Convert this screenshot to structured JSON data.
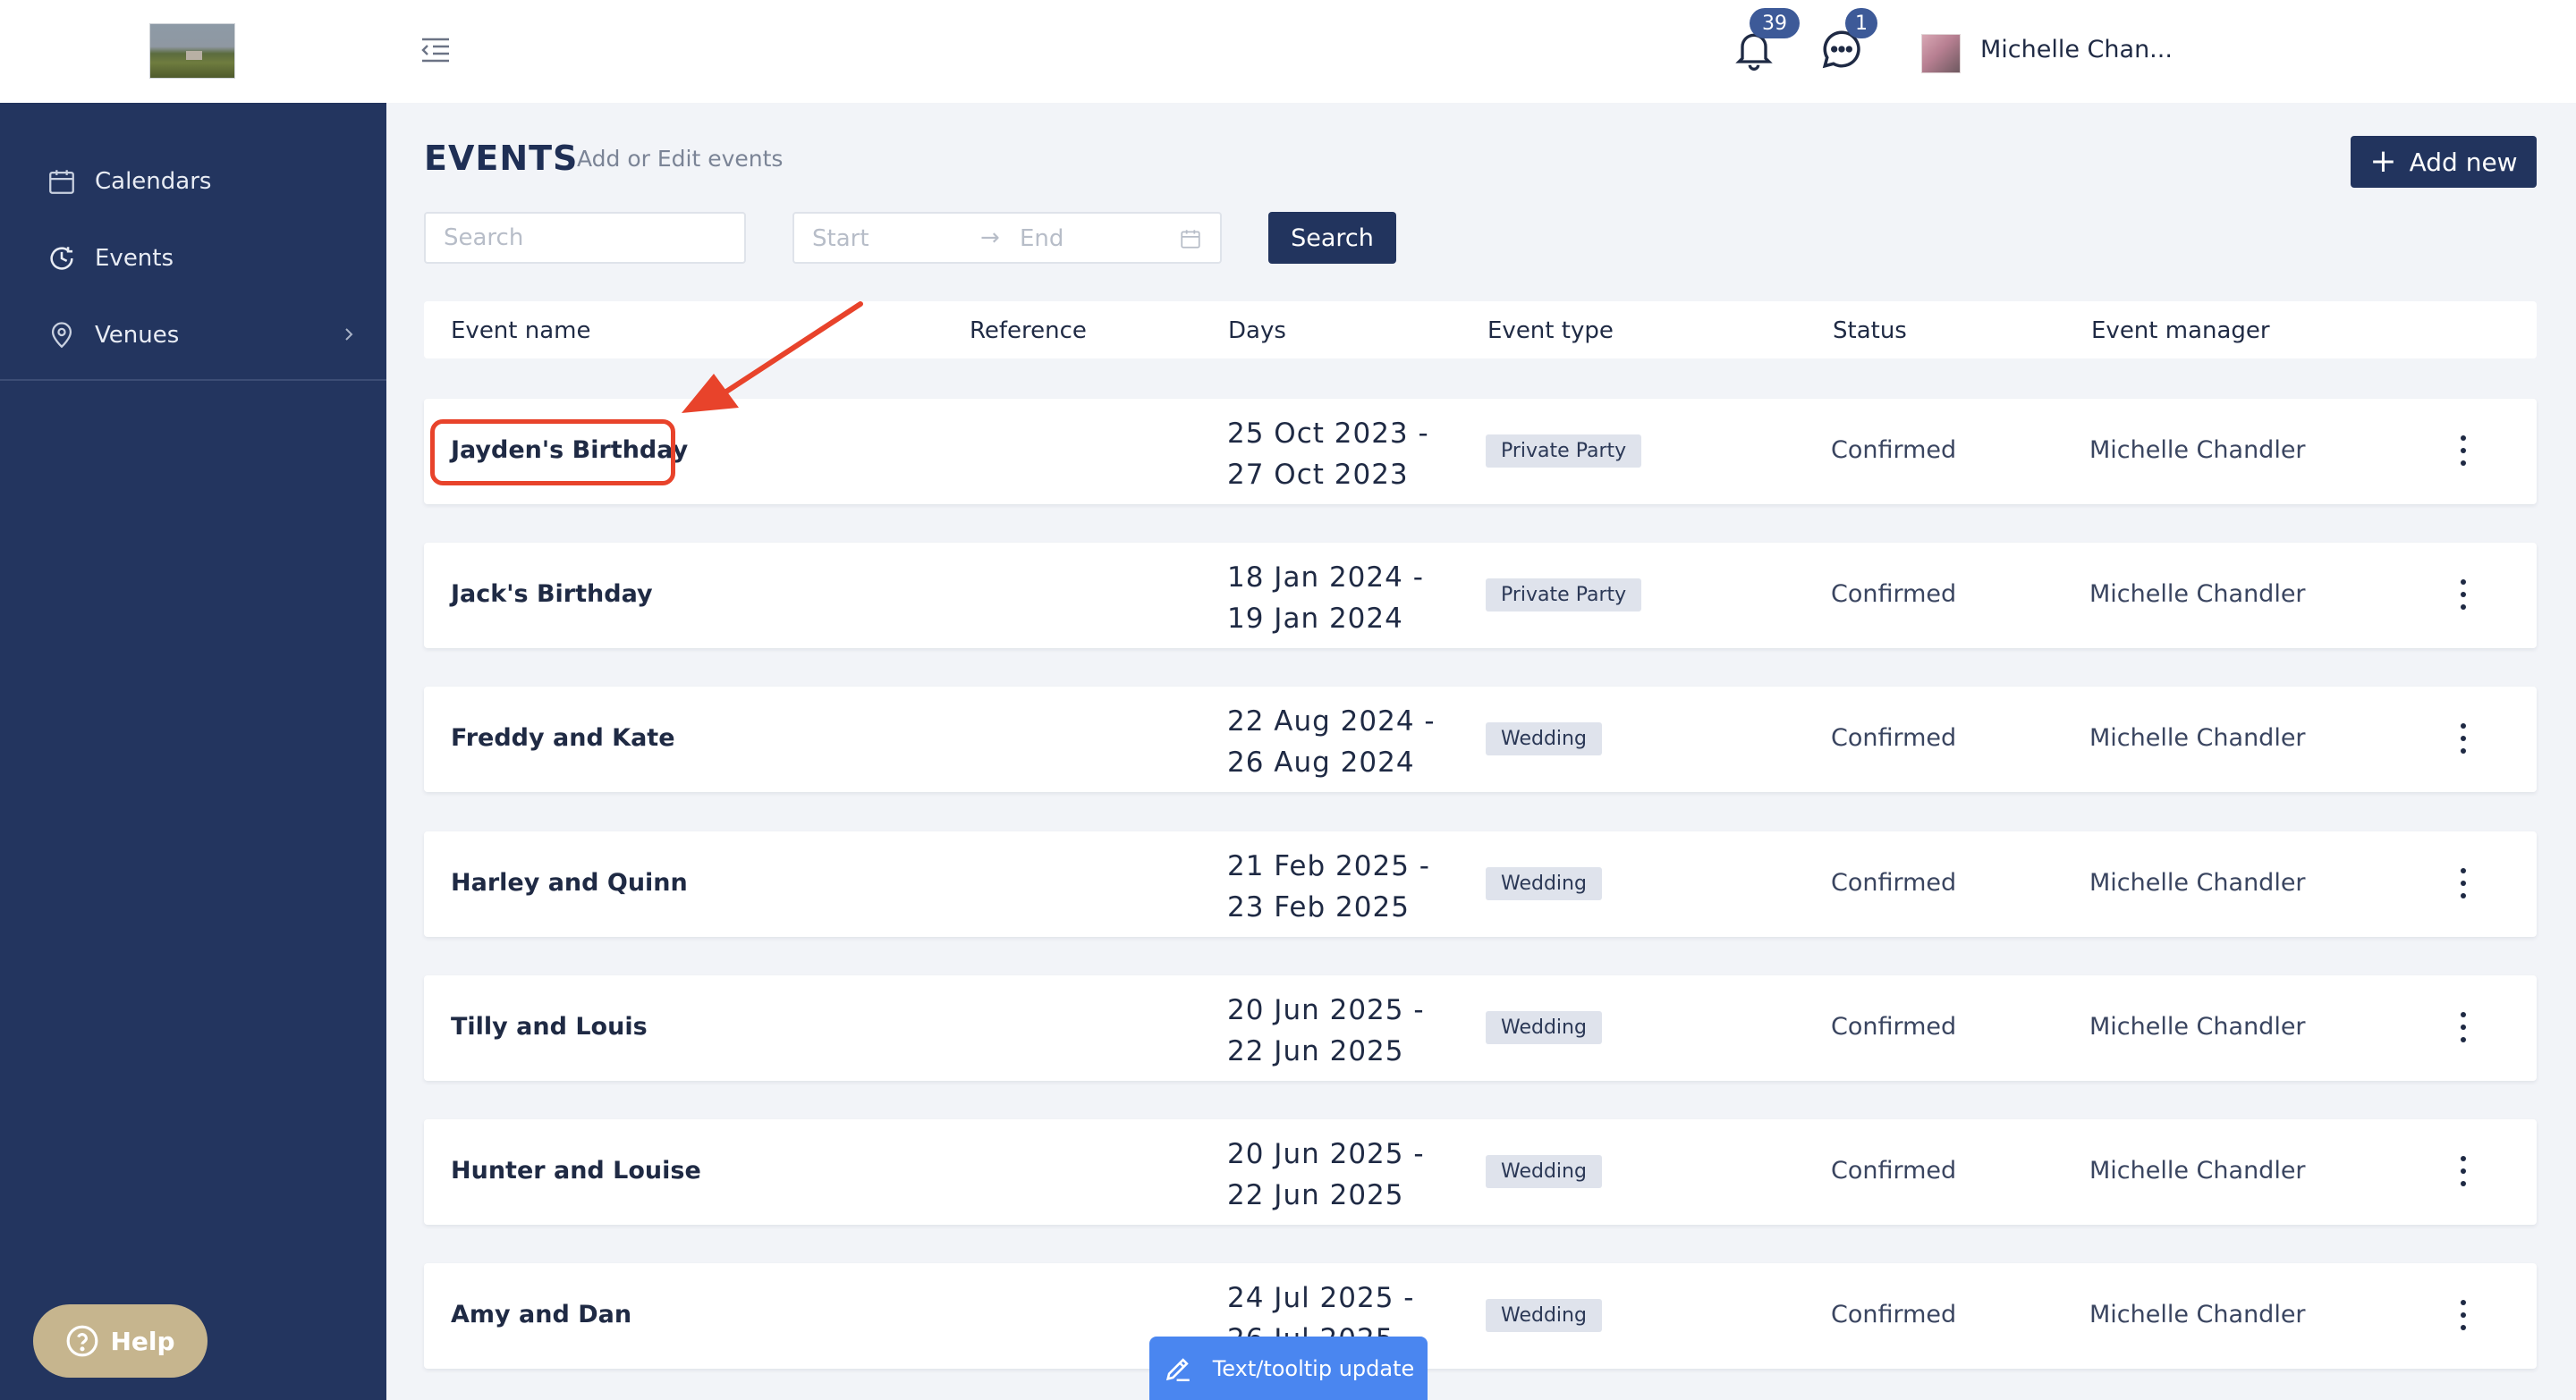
{
  "header": {
    "user_name": "Michelle Chan...",
    "notifications_count": "39",
    "messages_count": "1"
  },
  "sidebar": {
    "items": [
      {
        "label": "Calendars",
        "icon": "calendar-icon"
      },
      {
        "label": "Events",
        "icon": "clock-history-icon"
      },
      {
        "label": "Venues",
        "icon": "location-pin-icon"
      }
    ],
    "help_label": "Help"
  },
  "page": {
    "title": "EVENTS",
    "subtitle": "Add or Edit events",
    "add_button_label": "Add new"
  },
  "filters": {
    "search_placeholder": "Search",
    "start_placeholder": "Start",
    "end_placeholder": "End",
    "search_button_label": "Search"
  },
  "table": {
    "columns": [
      "Event name",
      "Reference",
      "Days",
      "Event type",
      "Status",
      "Event manager"
    ],
    "rows": [
      {
        "name": "Jayden's Birthday",
        "reference": "",
        "days_start": "25 Oct 2023 -",
        "days_end": "27 Oct 2023",
        "type": "Private Party",
        "status": "Confirmed",
        "manager": "Michelle Chandler"
      },
      {
        "name": "Jack's Birthday",
        "reference": "",
        "days_start": "18 Jan 2024 -",
        "days_end": "19 Jan 2024",
        "type": "Private Party",
        "status": "Confirmed",
        "manager": "Michelle Chandler"
      },
      {
        "name": "Freddy and Kate",
        "reference": "",
        "days_start": "22 Aug 2024 -",
        "days_end": "26 Aug 2024",
        "type": "Wedding",
        "status": "Confirmed",
        "manager": "Michelle Chandler"
      },
      {
        "name": "Harley and Quinn",
        "reference": "",
        "days_start": "21 Feb 2025 -",
        "days_end": "23 Feb 2025",
        "type": "Wedding",
        "status": "Confirmed",
        "manager": "Michelle Chandler"
      },
      {
        "name": "Tilly and Louis",
        "reference": "",
        "days_start": "20 Jun 2025 -",
        "days_end": "22 Jun 2025",
        "type": "Wedding",
        "status": "Confirmed",
        "manager": "Michelle Chandler"
      },
      {
        "name": "Hunter and Louise",
        "reference": "",
        "days_start": "20 Jun 2025 -",
        "days_end": "22 Jun 2025",
        "type": "Wedding",
        "status": "Confirmed",
        "manager": "Michelle Chandler"
      },
      {
        "name": "Amy and Dan",
        "reference": "",
        "days_start": "24 Jul 2025 -",
        "days_end": "26 Jul 2025",
        "type": "Wedding",
        "status": "Confirmed",
        "manager": "Michelle Chandler"
      }
    ]
  },
  "floating": {
    "tooltip_update_label": "Text/tooltip update"
  },
  "colors": {
    "sidebar_bg": "#23355f",
    "primary_button": "#22345e",
    "badge": "#3d5a98",
    "annotation": "#e8432b",
    "help_button": "#c6b58e",
    "tooltip_button": "#4a86f0"
  }
}
